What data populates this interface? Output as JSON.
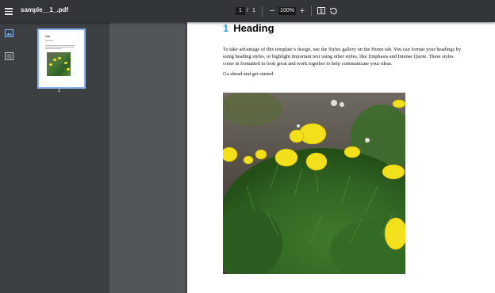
{
  "toolbar": {
    "title": "sample__1_.pdf",
    "current_page": "1",
    "page_separator": "/",
    "total_pages": "1",
    "zoom_out_label": "−",
    "zoom_level": "100%",
    "zoom_in_label": "+",
    "icons": [
      "menu-icon",
      "fit-page-icon",
      "rotate-icon"
    ]
  },
  "sidebar": {
    "icons": [
      "thumbnails-icon",
      "document-outline-icon"
    ],
    "thumbnail": {
      "title": "Title",
      "page_number": "1"
    }
  },
  "document": {
    "heading_number": "1",
    "heading_text": "Heading",
    "paragraph_1": "To take advantage of this template’s design, use the Styles gallery on the Home tab. You can format your headings by using heading styles, or highlight important text using other styles, like Emphasis and Intense Quote. These styles come in formatted to look great and work together to help communicate your ideas.",
    "paragraph_2": "Go ahead and get started.",
    "image_subject": "yellow flowers with green foliage"
  },
  "colors": {
    "toolbar_bg": "#323639",
    "sidebar_bg": "#3c4043",
    "viewer_bg": "#525659",
    "accent_selected": "#8ab4f8",
    "heading_number": "#3aa5e0"
  }
}
